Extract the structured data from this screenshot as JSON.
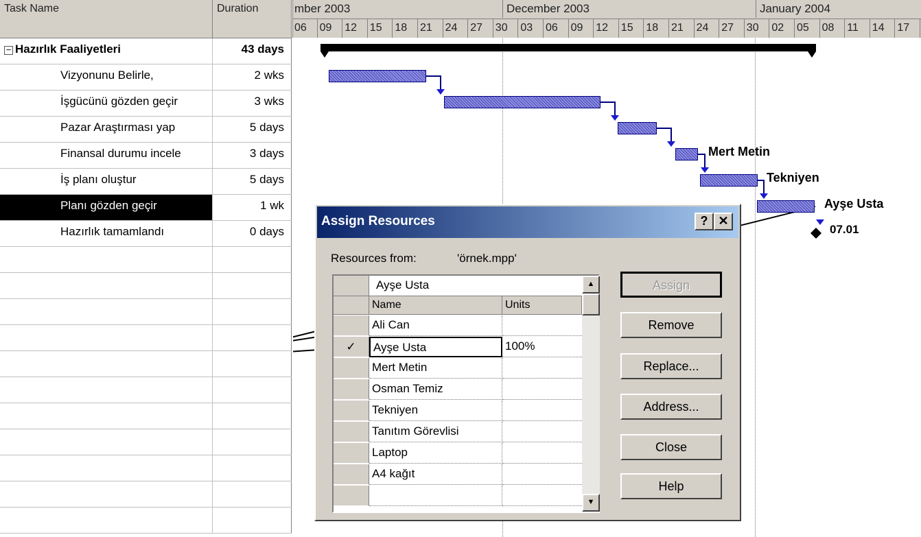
{
  "table": {
    "headers": {
      "task_name": "Task Name",
      "duration": "Duration"
    },
    "rows": [
      {
        "name": "Hazırlık Faaliyetleri",
        "duration": "43 days",
        "summary": true
      },
      {
        "name": "Vizyonunu Belirle,",
        "duration": "2 wks"
      },
      {
        "name": "İşgücünü gözden geçir",
        "duration": "3 wks"
      },
      {
        "name": "Pazar Araştırması yap",
        "duration": "5 days"
      },
      {
        "name": "Finansal durumu incele",
        "duration": "3 days"
      },
      {
        "name": "İş planı oluştur",
        "duration": "5 days"
      },
      {
        "name": "Planı gözden geçir",
        "duration": "1 wk",
        "selected": true
      },
      {
        "name": "Hazırlık tamamlandı",
        "duration": "0 days"
      }
    ],
    "collapse_symbol": "−"
  },
  "gantt": {
    "months": [
      "mber 2003",
      "December 2003",
      "January 2004"
    ],
    "days": [
      "06",
      "09",
      "12",
      "15",
      "18",
      "21",
      "24",
      "27",
      "30",
      "03",
      "06",
      "09",
      "12",
      "15",
      "18",
      "21",
      "24",
      "27",
      "30",
      "02",
      "05",
      "08",
      "11",
      "14",
      "17"
    ],
    "resource_labels": [
      "Mert Metin",
      "Tekniyen",
      "Ayşe Usta"
    ],
    "milestone_label": "07.01",
    "bar_color": "#6b6bd6"
  },
  "dialog": {
    "title": "Assign Resources",
    "help_btn": "?",
    "close_btn": "✕",
    "resources_from_label": "Resources from:",
    "resources_from_value": "'örnek.mpp'",
    "entry_value": "Ayşe Usta",
    "columns": {
      "name": "Name",
      "units": "Units"
    },
    "resources": [
      {
        "name": "Ali Can",
        "units": "",
        "check": ""
      },
      {
        "name": "Ayşe Usta",
        "units": "100%",
        "check": "✓"
      },
      {
        "name": "Mert Metin",
        "units": "",
        "check": ""
      },
      {
        "name": "Osman Temiz",
        "units": "",
        "check": ""
      },
      {
        "name": "Tekniyen",
        "units": "",
        "check": ""
      },
      {
        "name": "Tanıtım Görevlisi",
        "units": "",
        "check": ""
      },
      {
        "name": "Laptop",
        "units": "",
        "check": ""
      },
      {
        "name": "A4 kağıt",
        "units": "",
        "check": ""
      },
      {
        "name": "",
        "units": "",
        "check": ""
      }
    ],
    "buttons": {
      "assign": "Assign",
      "remove": "Remove",
      "replace": "Replace...",
      "address": "Address...",
      "close": "Close",
      "help": "Help"
    },
    "title_gradient": [
      "#0a246a",
      "#a6caf0"
    ]
  }
}
